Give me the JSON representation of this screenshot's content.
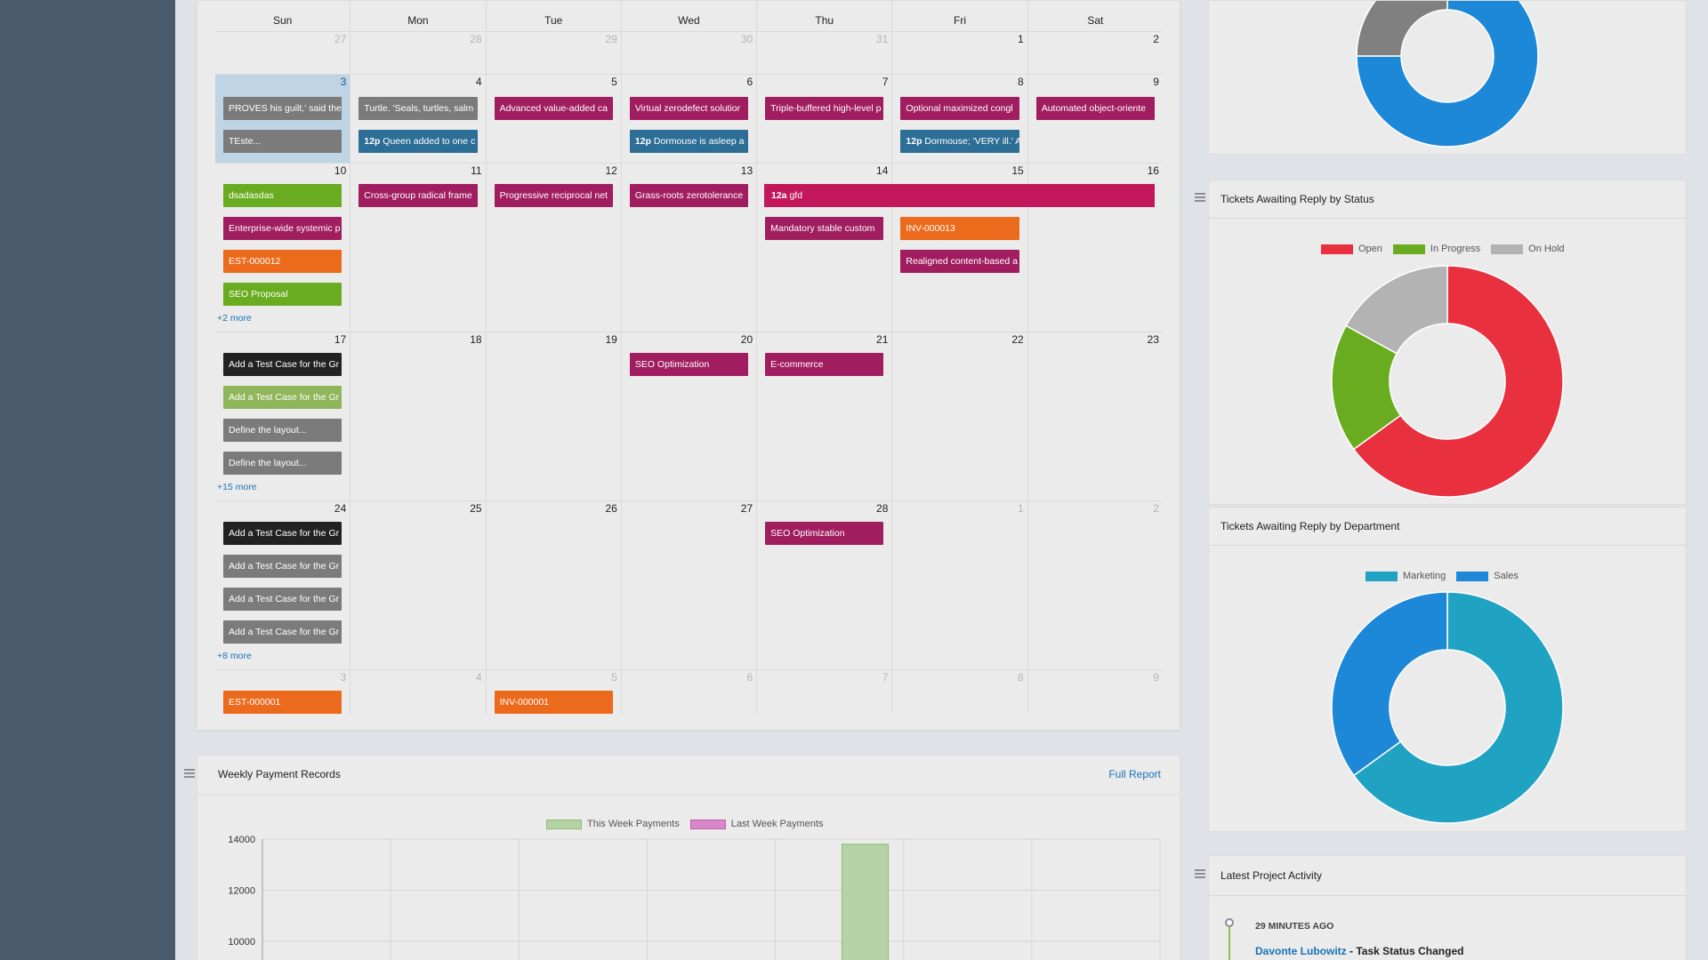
{
  "calendar": {
    "weekdays": [
      "Sun",
      "Mon",
      "Tue",
      "Wed",
      "Thu",
      "Fri",
      "Sat"
    ],
    "weeks": [
      {
        "days": [
          [
            "27",
            true
          ],
          [
            "28",
            true
          ],
          [
            "29",
            true
          ],
          [
            "30",
            true
          ],
          [
            "31",
            true
          ],
          [
            "1",
            false
          ],
          [
            "2",
            false
          ]
        ]
      },
      {
        "days": [
          [
            "3",
            false
          ],
          [
            "4",
            false
          ],
          [
            "5",
            false
          ],
          [
            "6",
            false
          ],
          [
            "7",
            false
          ],
          [
            "8",
            false
          ],
          [
            "9",
            false
          ]
        ]
      },
      {
        "days": [
          [
            "10",
            false
          ],
          [
            "11",
            false
          ],
          [
            "12",
            false
          ],
          [
            "13",
            false
          ],
          [
            "14",
            false
          ],
          [
            "15",
            false
          ],
          [
            "16",
            false
          ]
        ]
      },
      {
        "days": [
          [
            "17",
            false
          ],
          [
            "18",
            false
          ],
          [
            "19",
            false
          ],
          [
            "20",
            false
          ],
          [
            "21",
            false
          ],
          [
            "22",
            false
          ],
          [
            "23",
            false
          ]
        ]
      },
      {
        "days": [
          [
            "24",
            false
          ],
          [
            "25",
            false
          ],
          [
            "26",
            false
          ],
          [
            "27",
            false
          ],
          [
            "28",
            false
          ],
          [
            "1",
            true
          ],
          [
            "2",
            true
          ]
        ]
      },
      {
        "days": [
          [
            "3",
            true
          ],
          [
            "4",
            true
          ],
          [
            "5",
            true
          ],
          [
            "6",
            true
          ],
          [
            "7",
            true
          ],
          [
            "8",
            true
          ],
          [
            "9",
            true
          ]
        ]
      }
    ],
    "events": {
      "w1": {
        "sun": [
          "PROVES his guilt,' said the",
          "TEste..."
        ],
        "mon": [
          "Turtle. 'Seals, turtles, salm",
          "Queen added to one c"
        ],
        "tue": [
          "Advanced value-added ca"
        ],
        "wed": [
          "Virtual zerodefect solutior",
          "Dormouse is asleep a"
        ],
        "thu": [
          "Triple-buffered high-level p"
        ],
        "fri": [
          "Optional maximized congl",
          "Dormouse; 'VERY ill.' A"
        ],
        "sat": [
          "Automated object-oriente"
        ],
        "time_label": "12p"
      },
      "w2": {
        "sun": [
          "dsadasdas",
          "Enterprise-wide systemic p",
          "EST-000012",
          "SEO Proposal"
        ],
        "sun_more": "+2 more",
        "mon": [
          "Cross-group radical frame"
        ],
        "tue": [
          "Progressive reciprocal net"
        ],
        "wed": [
          "Grass-roots zerotolerance"
        ],
        "span_time": "12a",
        "span_title": "gfd",
        "thu": [
          "Mandatory stable custom"
        ],
        "fri": [
          "INV-000013",
          "Realigned content-based a"
        ]
      },
      "w3": {
        "sun": [
          "Add a Test Case for the Gr",
          "Add a Test Case for the Gr",
          "Define the layout...",
          "Define the layout..."
        ],
        "sun_more": "+15 more",
        "wed": [
          "SEO Optimization"
        ],
        "thu": [
          "E-commerce"
        ]
      },
      "w4": {
        "sun": [
          "Add a Test Case for the Gr",
          "Add a Test Case for the Gr",
          "Add a Test Case for the Gr",
          "Add a Test Case for the Gr"
        ],
        "sun_more": "+8 more",
        "thu": [
          "SEO Optimization"
        ]
      },
      "w5": {
        "sun": [
          "EST-000001"
        ],
        "tue": [
          "INV-000001"
        ]
      }
    }
  },
  "payments": {
    "title": "Weekly Payment Records",
    "full_report": "Full Report",
    "legend": [
      "This Week Payments",
      "Last Week Payments"
    ]
  },
  "status_panel": {
    "title": "Tickets Awaiting Reply by Status",
    "legend": [
      "Open",
      "In Progress",
      "On Hold"
    ]
  },
  "dept_panel": {
    "title": "Tickets Awaiting Reply by Department",
    "legend": [
      "Marketing",
      "Sales"
    ]
  },
  "activity": {
    "title": "Latest Project Activity",
    "time": "29 MINUTES AGO",
    "user": "Davonte Lubowitz",
    "action": " - Task Status Changed"
  },
  "chart_data": [
    {
      "type": "pie",
      "title": "",
      "labels": [
        "Blue",
        "Gray"
      ],
      "values": [
        75,
        25
      ],
      "colors": [
        "#1e88d8",
        "#808080"
      ]
    },
    {
      "type": "pie",
      "title": "Tickets Awaiting Reply by Status",
      "labels": [
        "Open",
        "In Progress",
        "On Hold"
      ],
      "values": [
        65,
        18,
        17
      ],
      "colors": [
        "#e8303f",
        "#6aac20",
        "#b3b3b3"
      ],
      "legend_position": "top"
    },
    {
      "type": "pie",
      "title": "Tickets Awaiting Reply by Department",
      "labels": [
        "Marketing",
        "Sales"
      ],
      "values": [
        65,
        35
      ],
      "colors": [
        "#20a2c2",
        "#1e88d8"
      ],
      "legend_position": "top"
    },
    {
      "type": "bar",
      "title": "Weekly Payment Records",
      "series": [
        {
          "name": "This Week Payments",
          "values": [
            0,
            0,
            0,
            0,
            13800,
            0,
            0
          ]
        },
        {
          "name": "Last Week Payments",
          "values": [
            0,
            0,
            0,
            0,
            0,
            0,
            0
          ]
        }
      ],
      "yticks": [
        10000,
        12000,
        14000
      ],
      "ylim": [
        10000,
        14000
      ],
      "grid": true,
      "colors": [
        "#b6d3a7",
        "#d987c8"
      ]
    }
  ]
}
